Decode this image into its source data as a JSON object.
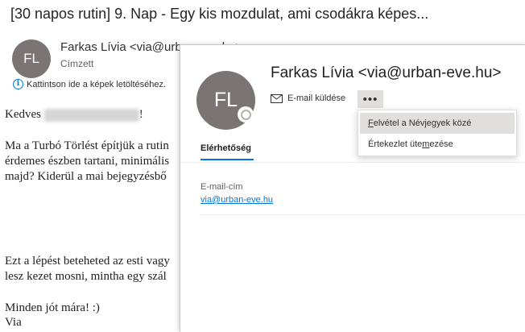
{
  "email": {
    "subject": "[30 napos rutin] 9. Nap - Egy kis mozdulat, ami csodákra képes...",
    "sender": {
      "initials": "FL",
      "display": "Farkas Lívia <via@urban-eve.hu>",
      "to_label": "Címzett"
    },
    "info_bar": "Kattintson ide a képek letöltéséhez.",
    "body": {
      "greeting_start": "Kedves",
      "greeting_end": "!",
      "p1_line1": "Ma a Turbó Törlést építjük a rutin",
      "p1_line2": "érdemes észben tartani, minimális",
      "p1_line3": "majd? Kiderül a mai bejegyzésbő",
      "p2_line1": "Ezt a lépést beteheted az esti vagy",
      "p2_line2": "lesz kezet mosni, mintha egy szál",
      "closing": "Minden jót mára! :)",
      "signature": "Via"
    }
  },
  "contact_card": {
    "initials": "FL",
    "name": "Farkas Lívia <via@urban-eve.hu>",
    "send_email_label": "E-mail küldése",
    "more_label": "•••",
    "tab_label": "Elérhetőség",
    "email_field_label": "E-mail-cím",
    "email_value": "via@urban-eve.hu",
    "icons": {
      "mail": "mail-icon",
      "presence": "presence-unknown-icon"
    }
  },
  "menu": {
    "items": [
      {
        "prefix": "",
        "accel": "F",
        "suffix": "elvétel a Névjegyek közé"
      },
      {
        "prefix": "Értekezlet üte",
        "accel": "m",
        "suffix": "ezése"
      }
    ]
  },
  "colors": {
    "accent": "#0078d4",
    "avatar": "#7a7574",
    "menu_hover": "#e1dfdd"
  }
}
